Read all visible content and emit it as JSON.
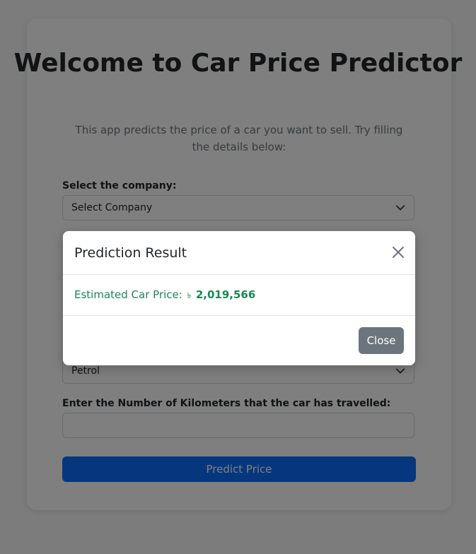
{
  "page": {
    "title": "Welcome to Car Price Predictor",
    "subtitle": "This app predicts the price of a car you want to sell. Try filling the details below:"
  },
  "form": {
    "company_label": "Select the company:",
    "company_value": "Select Company",
    "fuel_value": "Petrol",
    "kms_label": "Enter the Number of Kilometers that the car has travelled:",
    "kms_value": "",
    "predict_button": "Predict Price"
  },
  "modal": {
    "title": "Prediction Result",
    "result_prefix": "Estimated Car Price:",
    "currency_symbol": "৳",
    "result_value": "2,019,566",
    "close_button": "Close"
  },
  "colors": {
    "primary": "#0d6efd",
    "success": "#198754",
    "secondary": "#6c757d"
  },
  "icons": {
    "close": "close-icon",
    "dropdown": "chevron-down-icon"
  }
}
